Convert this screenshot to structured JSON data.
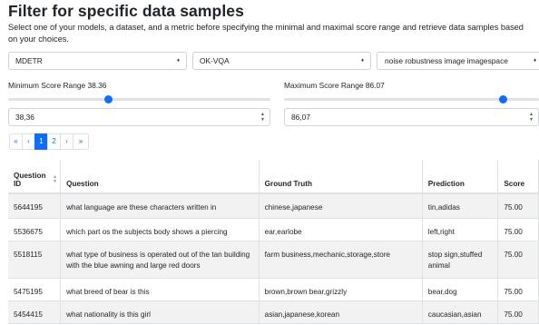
{
  "header": {
    "title": "Filter for specific data samples",
    "description": "Select one of your models, a dataset, and a metric before specifying the minimal and maximal score range and retrieve data samples based on your choices."
  },
  "selects": {
    "model": "MDETR",
    "dataset": "OK-VQA",
    "metric": "noise robustness image imagespace",
    "caret_icon": "♦"
  },
  "range": {
    "min_label": "Minimum Score Range 38.36",
    "max_label": "Maximum Score Range 86.07",
    "min_value": "38,36",
    "max_value": "86,07",
    "min_fraction": 0.3836,
    "max_fraction": 0.8607
  },
  "pagination": {
    "first": "«",
    "prev": "‹",
    "pages": [
      "1",
      "2"
    ],
    "next": "›",
    "last": "»",
    "active_page": "1"
  },
  "table": {
    "headers": [
      "Question ID",
      "Question",
      "Ground Truth",
      "Prediction",
      "Score"
    ],
    "rows": [
      {
        "id": "5644195",
        "question": "what language are these characters written in",
        "truth": "chinese,japanese",
        "prediction": "tin,adidas",
        "score": "75.00"
      },
      {
        "id": "5536675",
        "question": "which part os the subjects body shows a piercing",
        "truth": "ear,earlobe",
        "prediction": "left,right",
        "score": "75.00"
      },
      {
        "id": "5518115",
        "question": "what type of business is operated out of the tan building with the blue awning and large red doors",
        "truth": "farm business,mechanic,storage,store",
        "prediction": "stop sign,stuffed animal",
        "score": "75.00"
      },
      {
        "id": "5475195",
        "question": "what breed of bear is this",
        "truth": "brown,brown bear,grizzly",
        "prediction": "bear,dog",
        "score": "75.00"
      },
      {
        "id": "5454415",
        "question": "what nationality is this girl",
        "truth": "asian,japanese,korean",
        "prediction": "caucasian,asian",
        "score": "75.00"
      }
    ]
  },
  "colors": {
    "accent": "#0d6efd",
    "stripe": "#f2f2f2"
  }
}
